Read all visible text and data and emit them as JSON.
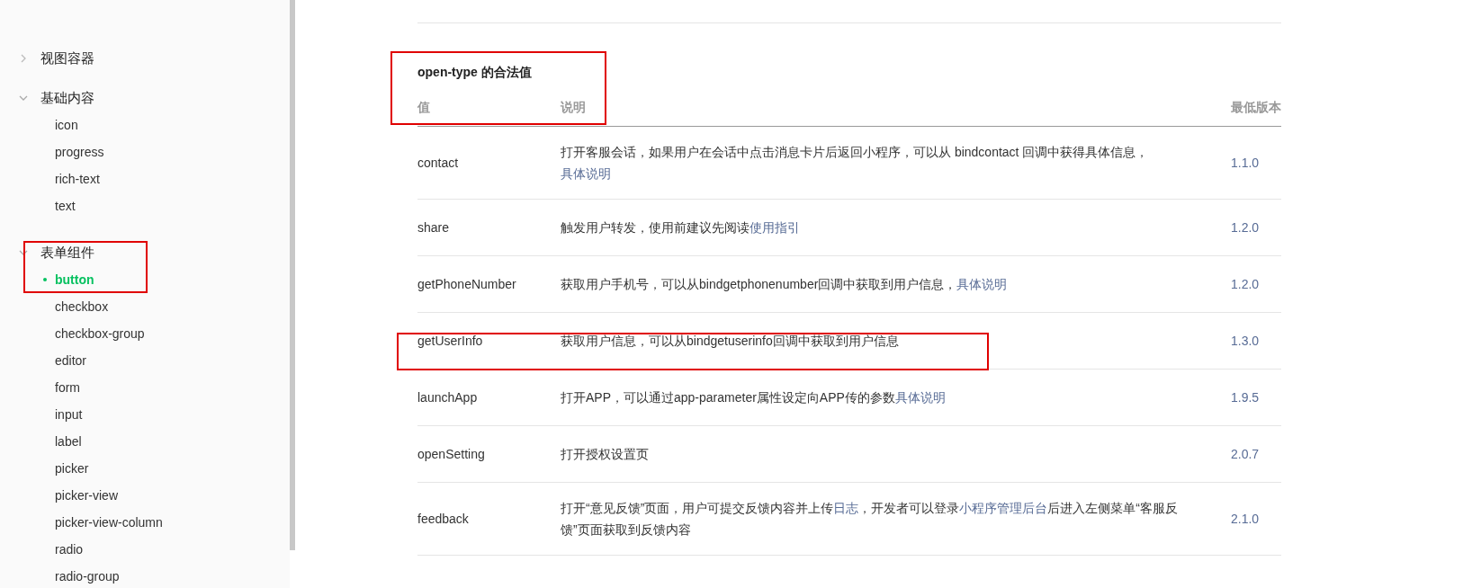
{
  "sidebar": {
    "groups": [
      {
        "label": "视图容器",
        "expanded": false
      },
      {
        "label": "基础内容",
        "expanded": true,
        "items": [
          {
            "label": "icon",
            "selected": false
          },
          {
            "label": "progress",
            "selected": false
          },
          {
            "label": "rich-text",
            "selected": false
          },
          {
            "label": "text",
            "selected": false
          }
        ]
      },
      {
        "label": "表单组件",
        "expanded": true,
        "items": [
          {
            "label": "button",
            "selected": true
          },
          {
            "label": "checkbox",
            "selected": false
          },
          {
            "label": "checkbox-group",
            "selected": false
          },
          {
            "label": "editor",
            "selected": false
          },
          {
            "label": "form",
            "selected": false
          },
          {
            "label": "input",
            "selected": false
          },
          {
            "label": "label",
            "selected": false
          },
          {
            "label": "picker",
            "selected": false
          },
          {
            "label": "picker-view",
            "selected": false
          },
          {
            "label": "picker-view-column",
            "selected": false
          },
          {
            "label": "radio",
            "selected": false
          },
          {
            "label": "radio-group",
            "selected": false
          }
        ]
      }
    ]
  },
  "section": {
    "title": "open-type 的合法值",
    "table": {
      "columns": [
        "值",
        "说明",
        "最低版本"
      ],
      "rows": [
        {
          "value": "contact",
          "description": [
            {
              "text": "打开客服会话，如果用户在会话中点击消息卡片后返回小程序，可以从 bindcontact 回调中获得具体信息，",
              "link": false
            },
            {
              "text": "具体说明",
              "link": true
            }
          ],
          "version": "1.1.0"
        },
        {
          "value": "share",
          "description": [
            {
              "text": "触发用户转发，使用前建议先阅读",
              "link": false
            },
            {
              "text": "使用指引",
              "link": true
            }
          ],
          "version": "1.2.0"
        },
        {
          "value": "getPhoneNumber",
          "description": [
            {
              "text": "获取用户手机号，可以从bindgetphonenumber回调中获取到用户信息，",
              "link": false
            },
            {
              "text": "具体说明",
              "link": true
            }
          ],
          "version": "1.2.0"
        },
        {
          "value": "getUserInfo",
          "description": [
            {
              "text": "获取用户信息，可以从bindgetuserinfo回调中获取到用户信息",
              "link": false
            }
          ],
          "version": "1.3.0"
        },
        {
          "value": "launchApp",
          "description": [
            {
              "text": "打开APP，可以通过app-parameter属性设定向APP传的参数",
              "link": false
            },
            {
              "text": "具体说明",
              "link": true
            }
          ],
          "version": "1.9.5"
        },
        {
          "value": "openSetting",
          "description": [
            {
              "text": "打开授权设置页",
              "link": false
            }
          ],
          "version": "2.0.7"
        },
        {
          "value": "feedback",
          "description": [
            {
              "text": "打开“意见反馈”页面，用户可提交反馈内容并上传",
              "link": false
            },
            {
              "text": "日志",
              "link": true
            },
            {
              "text": "，开发者可以登录",
              "link": false
            },
            {
              "text": "小程序管理后台",
              "link": true
            },
            {
              "text": "后进入左侧菜单“客服反馈”页面获取到反馈内容",
              "link": false
            }
          ],
          "version": "2.1.0"
        }
      ]
    }
  }
}
